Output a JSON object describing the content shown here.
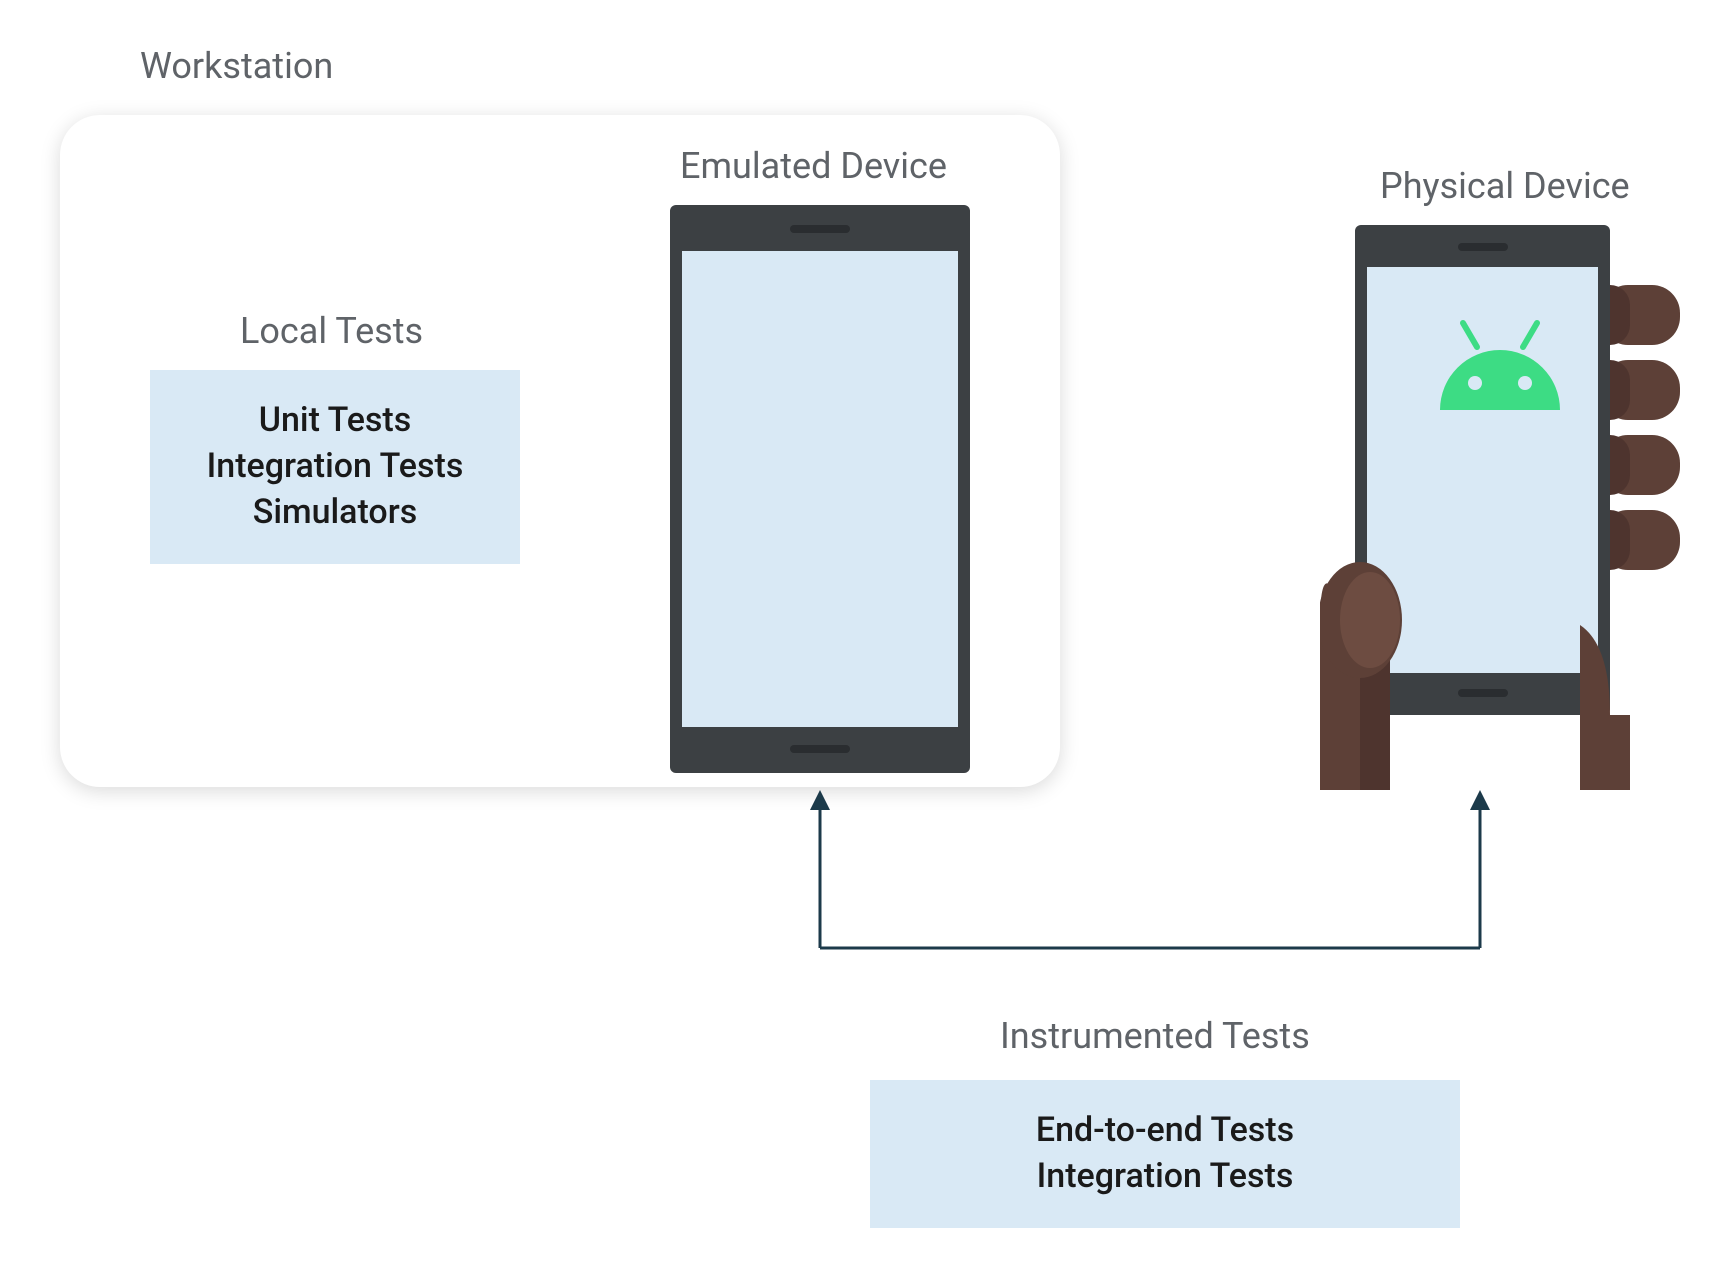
{
  "labels": {
    "workstation": "Workstation",
    "local_tests": "Local Tests",
    "emulated_device": "Emulated Device",
    "physical_device": "Physical Device",
    "instrumented_tests": "Instrumented Tests"
  },
  "local_tests_box": {
    "line1": "Unit Tests",
    "line2": "Integration Tests",
    "line3": "Simulators"
  },
  "instrumented_box": {
    "line1": "End-to-end Tests",
    "line2": "Integration Tests"
  },
  "colors": {
    "label_gray": "#5f6368",
    "box_blue": "#d9e9f5",
    "phone_dark": "#3c4043",
    "android_green": "#3ddc84",
    "hand_brown": "#5d4037",
    "arrow_dark": "#1c3a4a"
  }
}
